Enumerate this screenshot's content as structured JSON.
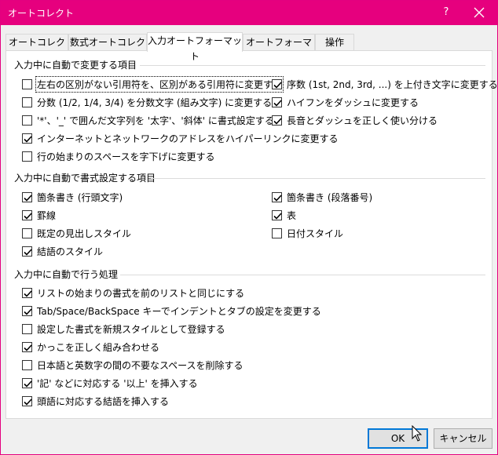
{
  "window": {
    "title": "オートコレクト",
    "help_label": "?"
  },
  "tabs": [
    {
      "label": "オートコレクト"
    },
    {
      "label": "数式オートコレクト"
    },
    {
      "label": "入力オートフォーマット"
    },
    {
      "label": "オートフォーマット"
    },
    {
      "label": "操作"
    }
  ],
  "active_tab": "入力オートフォーマット",
  "sections": [
    {
      "title": "入力中に自動で変更する項目",
      "items": [
        {
          "label": "左右の区別がない引用符を、区別がある引用符に変更する",
          "checked": false
        },
        {
          "label": "序数 (1st, 2nd, 3rd, ...) を上付き文字に変更する",
          "checked": true
        },
        {
          "label": "分数 (1/2, 1/4, 3/4) を分数文字 (組み文字) に変更する",
          "checked": false
        },
        {
          "label": "ハイフンをダッシュに変更する",
          "checked": true
        },
        {
          "label": "'*'、'_' で囲んだ文字列を '太字'、'斜体' に書式設定する",
          "checked": false
        },
        {
          "label": "長音とダッシュを正しく使い分ける",
          "checked": true
        },
        {
          "label": "インターネットとネットワークのアドレスをハイパーリンクに変更する",
          "checked": true
        },
        {
          "label": "行の始まりのスペースを字下げに変更する",
          "checked": false
        }
      ]
    },
    {
      "title": "入力中に自動で書式設定する項目",
      "items": [
        {
          "label": "箇条書き (行頭文字)",
          "checked": true
        },
        {
          "label": "箇条書き (段落番号)",
          "checked": true
        },
        {
          "label": "罫線",
          "checked": true
        },
        {
          "label": "表",
          "checked": true
        },
        {
          "label": "既定の見出しスタイル",
          "checked": false
        },
        {
          "label": "日付スタイル",
          "checked": false
        },
        {
          "label": "結語のスタイル",
          "checked": true
        }
      ]
    },
    {
      "title": "入力中に自動で行う処理",
      "items": [
        {
          "label": "リストの始まりの書式を前のリストと同じにする",
          "checked": true
        },
        {
          "label": "Tab/Space/BackSpace キーでインデントとタブの設定を変更する",
          "checked": true
        },
        {
          "label": "設定した書式を新規スタイルとして登録する",
          "checked": false
        },
        {
          "label": "かっこを正しく組み合わせる",
          "checked": true
        },
        {
          "label": "日本語と英数字の間の不要なスペースを削除する",
          "checked": false
        },
        {
          "label": "'記' などに対応する '以上' を挿入する",
          "checked": true
        },
        {
          "label": "頭語に対応する結語を挿入する",
          "checked": true
        }
      ]
    }
  ],
  "buttons": {
    "ok": "OK",
    "cancel": "キャンセル"
  },
  "colors": {
    "titlebar": "#e6007e",
    "default_button_border": "#0078d7"
  }
}
